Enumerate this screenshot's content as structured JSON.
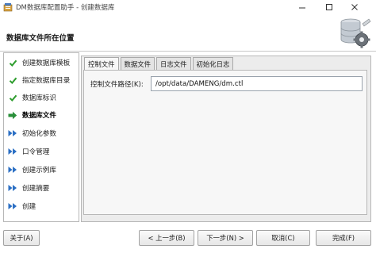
{
  "window": {
    "title": "DM数据库配置助手 - 创建数据库"
  },
  "header": {
    "title": "数据库文件所在位置",
    "logo_icon": "database-gear-icon"
  },
  "steps": [
    {
      "label": "创建数据库模板",
      "status": "done"
    },
    {
      "label": "指定数据库目录",
      "status": "done"
    },
    {
      "label": "数据库标识",
      "status": "done"
    },
    {
      "label": "数据库文件",
      "status": "current"
    },
    {
      "label": "初始化参数",
      "status": "pending"
    },
    {
      "label": "口令管理",
      "status": "pending"
    },
    {
      "label": "创建示例库",
      "status": "pending"
    },
    {
      "label": "创建摘要",
      "status": "pending"
    },
    {
      "label": "创建",
      "status": "pending"
    }
  ],
  "tabs": [
    {
      "label": "控制文件",
      "active": true
    },
    {
      "label": "数据文件",
      "active": false
    },
    {
      "label": "日志文件",
      "active": false
    },
    {
      "label": "初始化日志",
      "active": false
    }
  ],
  "control_file": {
    "label": "控制文件路径(K):",
    "value": "/opt/data/DAMENG/dm.ctl"
  },
  "buttons": {
    "about": "关于(A)",
    "prev": "< 上一步(B)",
    "next": "下一步(N) >",
    "cancel": "取消(C)",
    "finish": "完成(F)"
  },
  "colors": {
    "done_check": "#2e9d2e",
    "current_arrow": "#2a8f3a",
    "pending_arrow": "#2b6fc4"
  }
}
